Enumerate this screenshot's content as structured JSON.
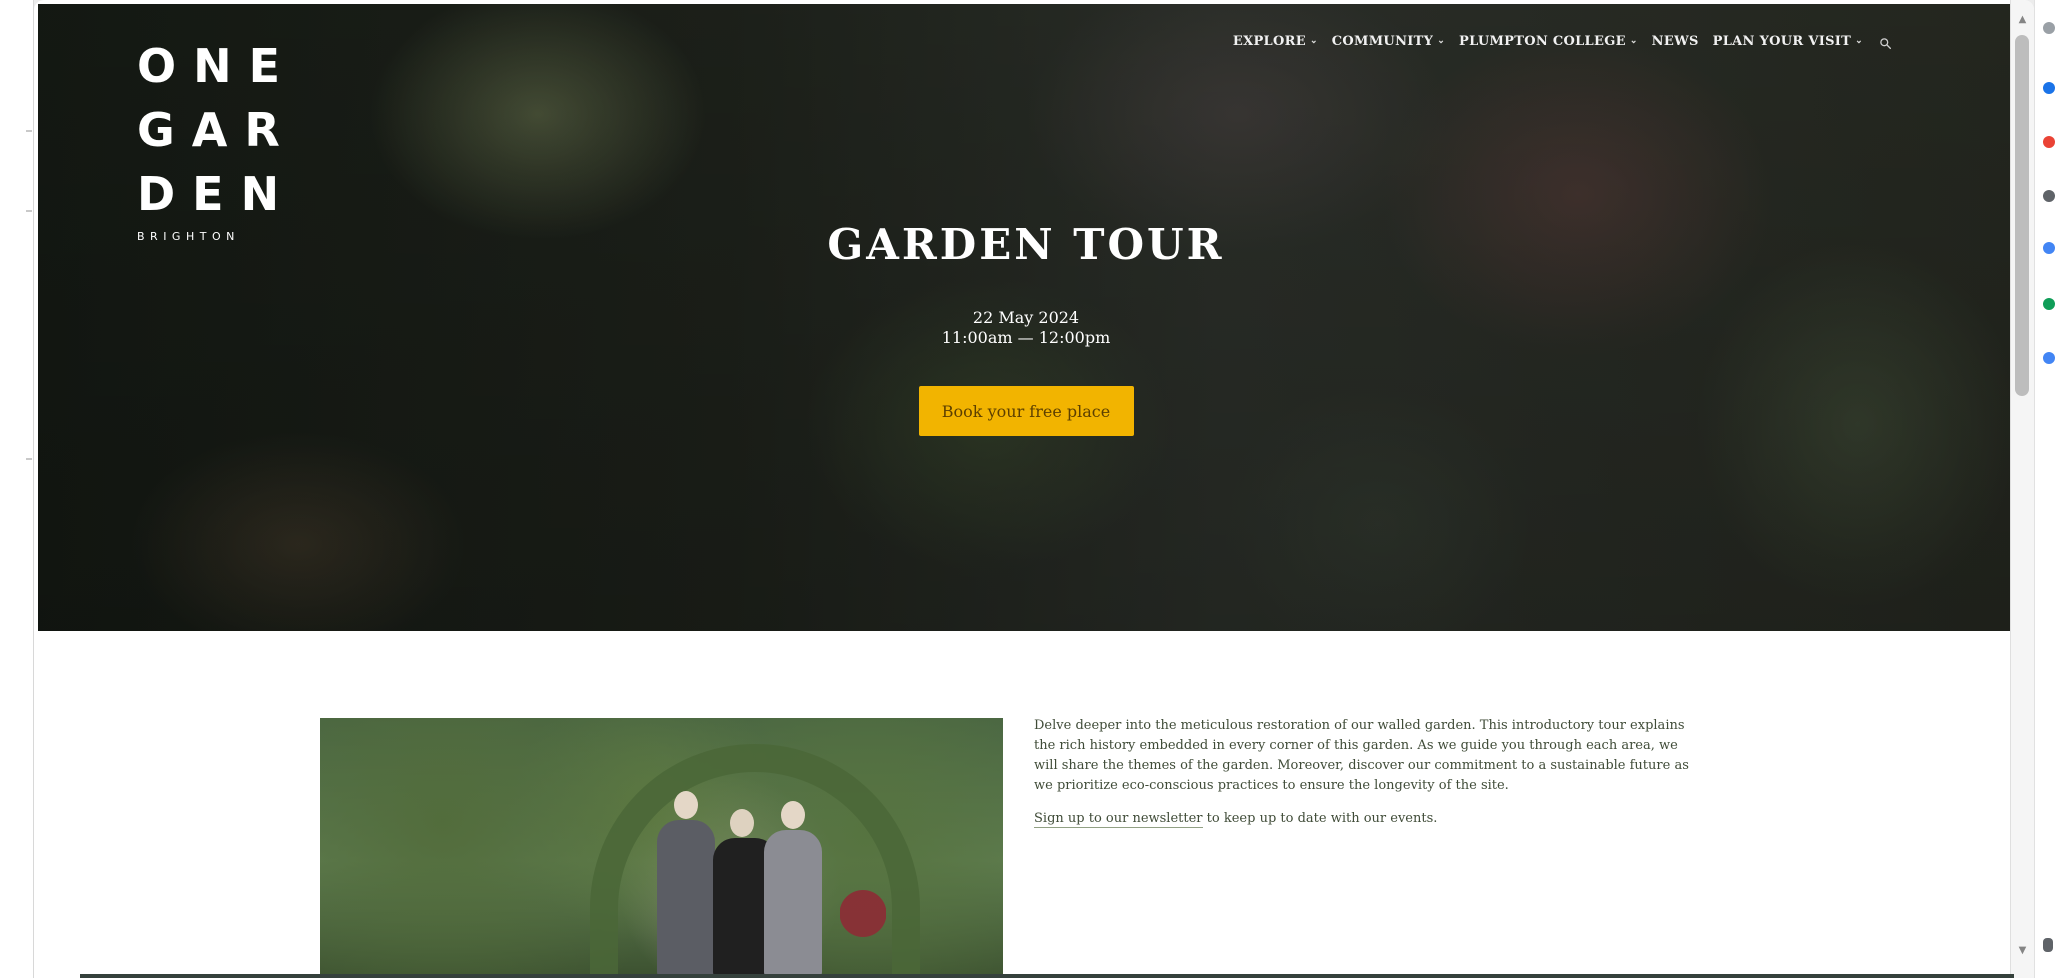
{
  "brand": {
    "logo_rows": [
      "ONE",
      "GAR",
      "DEN"
    ],
    "location": "BRIGHTON"
  },
  "nav": {
    "items": [
      {
        "label": "EXPLORE",
        "has_dropdown": true
      },
      {
        "label": "COMMUNITY",
        "has_dropdown": true
      },
      {
        "label": "PLUMPTON COLLEGE",
        "has_dropdown": true
      },
      {
        "label": "NEWS",
        "has_dropdown": false
      },
      {
        "label": "PLAN YOUR VISIT",
        "has_dropdown": true
      }
    ],
    "search_icon": "search-icon"
  },
  "hero": {
    "title": "GARDEN TOUR",
    "date": "22 May 2024",
    "time": "11:00am — 12:00pm",
    "button_label": "Book your free place"
  },
  "content": {
    "paragraph": "Delve deeper into the meticulous restoration of our walled garden. This introductory tour explains the rich history embedded in every corner of this garden. As we guide you through each area, we will share the themes of the garden. Moreover, discover our commitment to a sustainable future as we prioritize eco-conscious practices to ensure the longevity of the site.",
    "newsletter_link": "Sign up to our newsletter",
    "newsletter_suffix": " to keep up to date with our events."
  },
  "colors": {
    "accent": "#f2b400",
    "text_dark": "#3f4b37",
    "hero_dark": "#1e221b"
  },
  "ui": {
    "scroll_up_icon": "▲",
    "scroll_down_icon": "▼",
    "chevron_icon": "⌄"
  }
}
